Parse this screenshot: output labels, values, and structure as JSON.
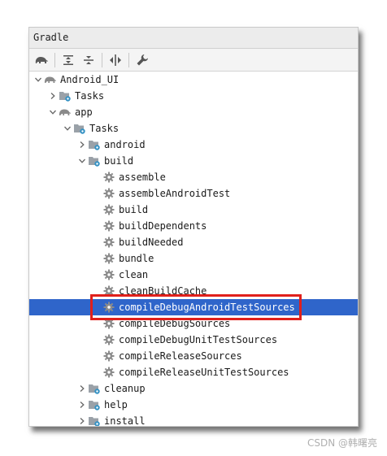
{
  "window": {
    "title": "Gradle"
  },
  "colors": {
    "selection": "#2f65ca",
    "highlight_border": "#e0201b"
  },
  "toolbar": {
    "buttons": [
      {
        "name": "elephant-icon"
      },
      {
        "name": "expand-all-icon"
      },
      {
        "name": "collapse-all-icon"
      },
      {
        "name": "toggle-offline-icon"
      },
      {
        "name": "wrench-icon"
      }
    ]
  },
  "tree": [
    {
      "label": "Android_UI",
      "depth": 0,
      "chevron": "down",
      "icon": "elephant-icon"
    },
    {
      "label": "Tasks",
      "depth": 1,
      "chevron": "right",
      "icon": "task-folder-icon"
    },
    {
      "label": "app",
      "depth": 1,
      "chevron": "down",
      "icon": "elephant-icon"
    },
    {
      "label": "Tasks",
      "depth": 2,
      "chevron": "down",
      "icon": "task-folder-icon"
    },
    {
      "label": "android",
      "depth": 3,
      "chevron": "right",
      "icon": "task-folder-icon"
    },
    {
      "label": "build",
      "depth": 3,
      "chevron": "down",
      "icon": "task-folder-icon"
    },
    {
      "label": "assemble",
      "depth": 4,
      "chevron": "none",
      "icon": "gear-icon"
    },
    {
      "label": "assembleAndroidTest",
      "depth": 4,
      "chevron": "none",
      "icon": "gear-icon"
    },
    {
      "label": "build",
      "depth": 4,
      "chevron": "none",
      "icon": "gear-icon"
    },
    {
      "label": "buildDependents",
      "depth": 4,
      "chevron": "none",
      "icon": "gear-icon"
    },
    {
      "label": "buildNeeded",
      "depth": 4,
      "chevron": "none",
      "icon": "gear-icon"
    },
    {
      "label": "bundle",
      "depth": 4,
      "chevron": "none",
      "icon": "gear-icon"
    },
    {
      "label": "clean",
      "depth": 4,
      "chevron": "none",
      "icon": "gear-icon"
    },
    {
      "label": "cleanBuildCache",
      "depth": 4,
      "chevron": "none",
      "icon": "gear-icon"
    },
    {
      "label": "compileDebugAndroidTestSources",
      "depth": 4,
      "chevron": "none",
      "icon": "gear-icon",
      "selected": true
    },
    {
      "label": "compileDebugSources",
      "depth": 4,
      "chevron": "none",
      "icon": "gear-icon"
    },
    {
      "label": "compileDebugUnitTestSources",
      "depth": 4,
      "chevron": "none",
      "icon": "gear-icon"
    },
    {
      "label": "compileReleaseSources",
      "depth": 4,
      "chevron": "none",
      "icon": "gear-icon"
    },
    {
      "label": "compileReleaseUnitTestSources",
      "depth": 4,
      "chevron": "none",
      "icon": "gear-icon"
    },
    {
      "label": "cleanup",
      "depth": 3,
      "chevron": "right",
      "icon": "task-folder-icon"
    },
    {
      "label": "help",
      "depth": 3,
      "chevron": "right",
      "icon": "task-folder-icon"
    },
    {
      "label": "install",
      "depth": 3,
      "chevron": "right",
      "icon": "task-folder-icon"
    }
  ],
  "watermark": "CSDN @韩曙亮"
}
